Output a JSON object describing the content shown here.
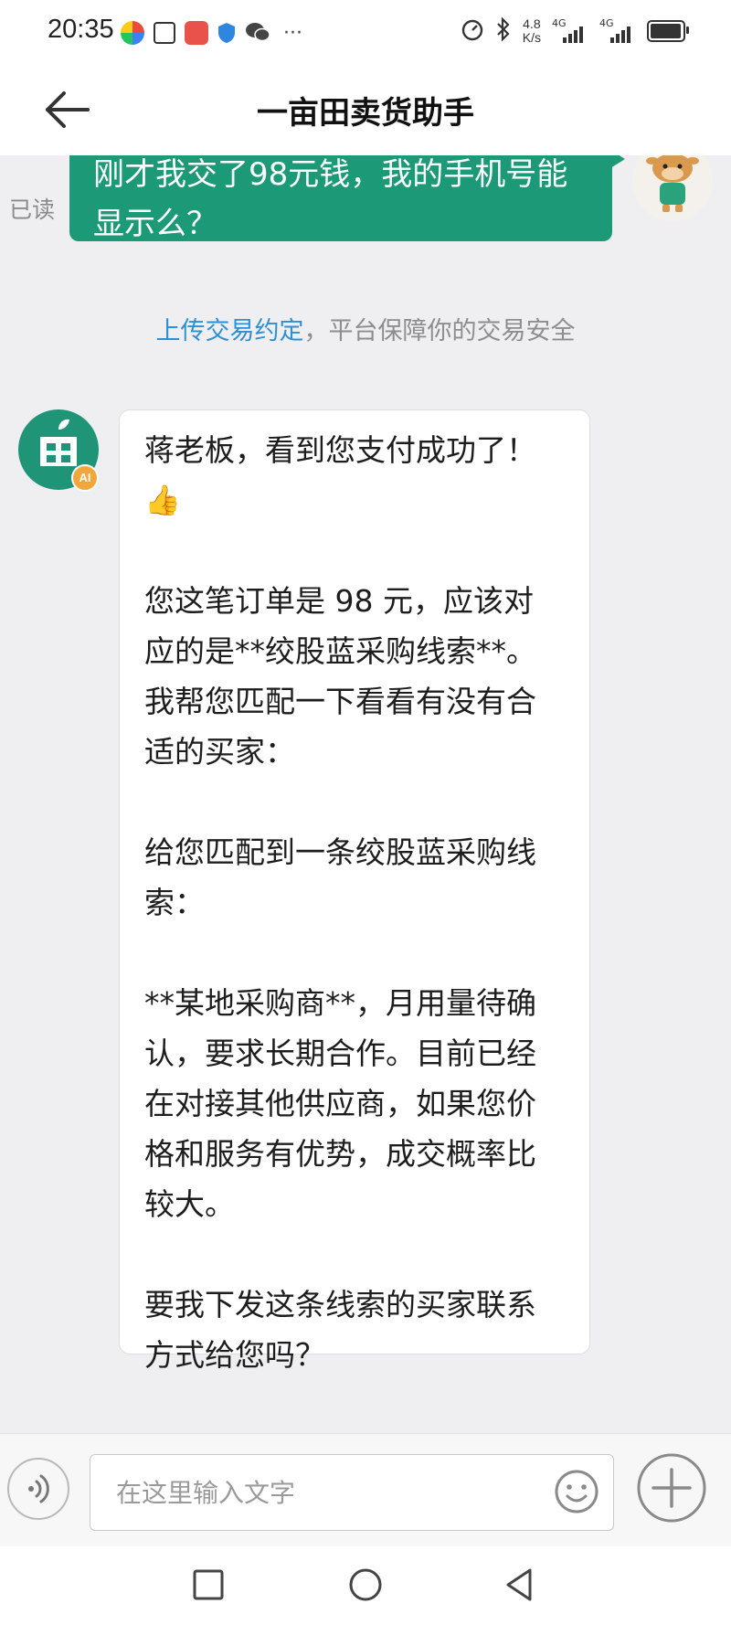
{
  "status_bar": {
    "time": "20:35",
    "network_speed_value": "4.8",
    "network_speed_unit": "K/s",
    "signal_1_label": "4G",
    "signal_2_label": "4G",
    "icons": [
      "app-icon-1",
      "calendar-icon",
      "mail-app-icon",
      "shield-icon",
      "wechat-icon",
      "more-dots-icon",
      "alarm-icon",
      "bluetooth-icon",
      "battery-icon"
    ]
  },
  "header": {
    "title": "一亩田卖货助手",
    "back_icon": "arrow-left-icon"
  },
  "chat": {
    "outgoing": {
      "read_status": "已读",
      "lines": [
        "刚才我交了98元钱，我的手机号能",
        "显示么？"
      ]
    },
    "notice": {
      "link": "上传交易约定",
      "text": "，平台保障你的交易安全"
    },
    "incoming": {
      "badge": "AI",
      "lines": [
        "蒋老板，看到您支付成功了！",
        "👍",
        "",
        "您这笔订单是 98 元，应该对",
        "应的是**绞股蓝采购线索**。",
        "我帮您匹配一下看看有没有合",
        "适的买家：",
        "",
        "给您匹配到一条绞股蓝采购线",
        "索：",
        "",
        "**某地采购商**，月用量待确",
        "认，要求长期合作。目前已经",
        "在对接其他供应商，如果您价",
        "格和服务有优势，成交概率比",
        "较大。",
        "",
        "要我下发这条线索的买家联系",
        "方式给您吗？"
      ]
    }
  },
  "input_bar": {
    "placeholder": "在这里输入文字",
    "value": ""
  },
  "colors": {
    "accent": "#1c9a78",
    "link": "#2d8fd5",
    "ai_badge": "#f3a73a"
  }
}
